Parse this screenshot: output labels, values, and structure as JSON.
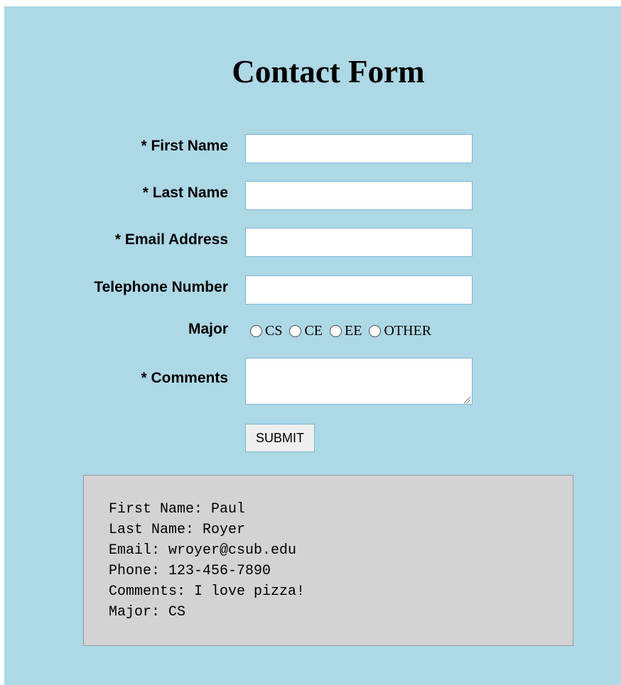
{
  "title": "Contact Form",
  "fields": {
    "first_name": {
      "label": "* First Name",
      "value": ""
    },
    "last_name": {
      "label": "* Last Name",
      "value": ""
    },
    "email": {
      "label": "* Email Address",
      "value": ""
    },
    "phone": {
      "label": "Telephone Number",
      "value": ""
    },
    "comments": {
      "label": "* Comments",
      "value": ""
    }
  },
  "major": {
    "label": "Major",
    "options": [
      "CS",
      "CE",
      "EE",
      "OTHER"
    ]
  },
  "submit_label": "SUBMIT",
  "output": {
    "lines": [
      "First Name: Paul",
      "Last Name: Royer",
      "Email: wroyer@csub.edu",
      "Phone: 123-456-7890",
      "Comments: I love pizza!",
      "Major: CS"
    ]
  },
  "colors": {
    "background": "#add8e6",
    "output_background": "#d3d3d3",
    "field_border": "#7ab8d4"
  }
}
